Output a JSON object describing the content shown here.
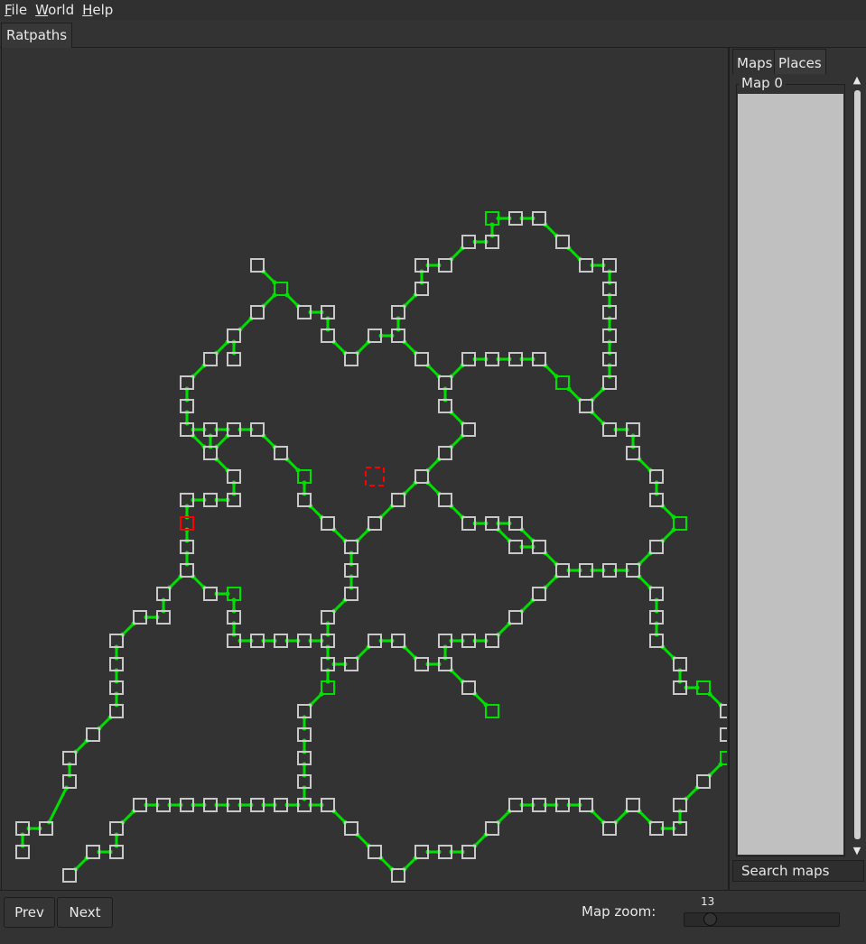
{
  "menu": {
    "file": {
      "underline": "F",
      "rest": "ile"
    },
    "world": {
      "underline": "W",
      "rest": "orld"
    },
    "help": {
      "underline": "H",
      "rest": "elp"
    }
  },
  "main_tab": "Ratpaths",
  "side_tabs": {
    "maps": "Maps",
    "places": "Places"
  },
  "map_list": {
    "title": "Map 0"
  },
  "search": {
    "placeholder": "Search maps"
  },
  "buttons": {
    "prev": "Prev",
    "next": "Next"
  },
  "zoom": {
    "label": "Map zoom:",
    "value": "13",
    "level_fraction": 0.13
  },
  "colors": {
    "background": "#333333",
    "room_outline": "#c8c8c8",
    "path": "#00e000",
    "highlight_room": "#00e000",
    "current_room": "#ff0000",
    "list_background": "#c0c0c0"
  },
  "icons": {
    "scroll_up": "▲",
    "scroll_down": "▼"
  }
}
